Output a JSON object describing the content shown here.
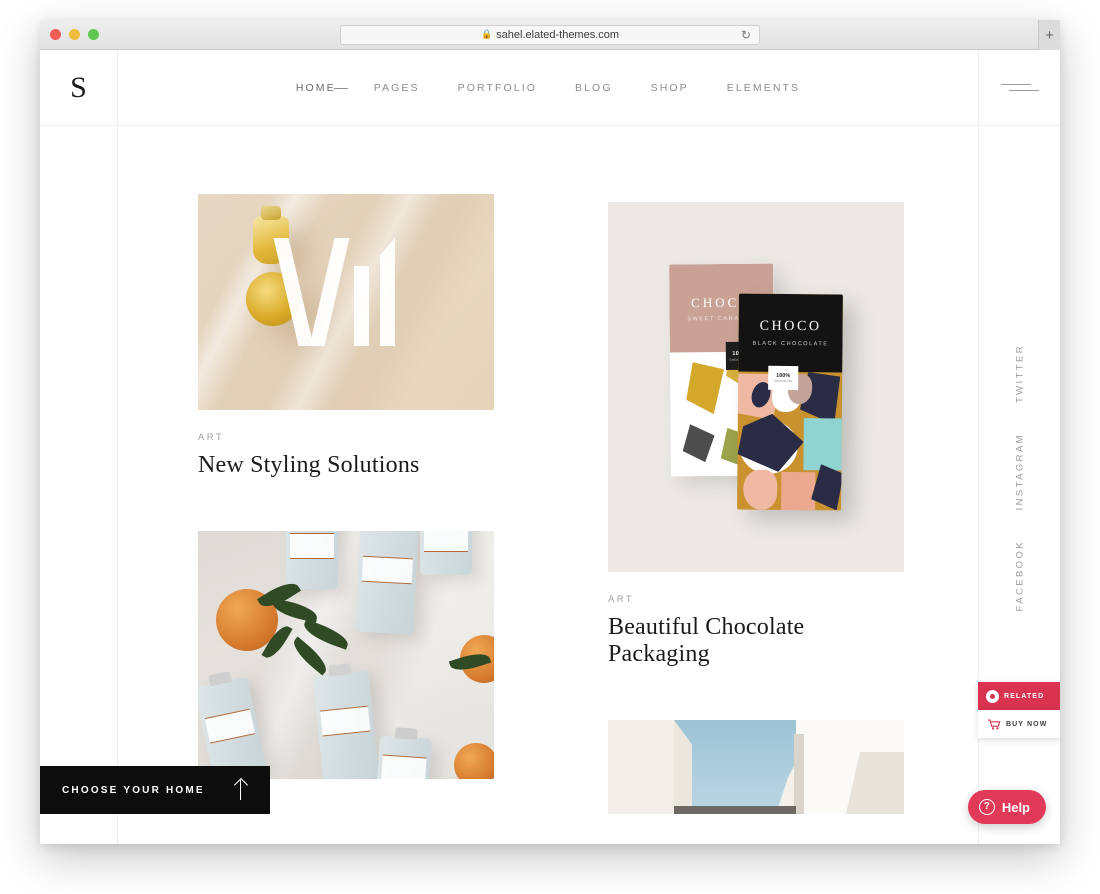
{
  "browser": {
    "url": "sahel.elated-themes.com",
    "lock_icon": "lock-icon",
    "reload_icon": "reload-icon",
    "new_tab_label": "+",
    "traffic_lights": [
      "close",
      "minimize",
      "maximize"
    ]
  },
  "header": {
    "logo": "S",
    "nav": [
      {
        "label": "HOME",
        "active": true
      },
      {
        "label": "PAGES",
        "active": false
      },
      {
        "label": "PORTFOLIO",
        "active": false
      },
      {
        "label": "BLOG",
        "active": false
      },
      {
        "label": "SHOP",
        "active": false
      },
      {
        "label": "ELEMENTS",
        "active": false
      }
    ],
    "menu_icon": "hamburger-icon"
  },
  "social": {
    "items": [
      {
        "label": "TWITTER"
      },
      {
        "label": "INSTAGRAM"
      },
      {
        "label": "FACEBOOK"
      }
    ]
  },
  "portfolio": {
    "left_column": [
      {
        "category": "ART",
        "title": "New Styling Solutions",
        "image": "olive-oil-on-marble"
      },
      {
        "category": "",
        "title": "",
        "image": "bottles-and-oranges"
      }
    ],
    "right_column": [
      {
        "category": "ART",
        "title": "Beautiful Chocolate Packaging",
        "image": "choco-packaging",
        "artwork": {
          "bar_caramel_title": "CHOCO",
          "bar_caramel_sub": "SWEET CARAMEL",
          "bar_caramel_badge": "100%",
          "bar_caramel_badge_sub": "CHOCOLATE",
          "bar_black_title": "CHOCO",
          "bar_black_sub": "BLACK CHOCOLATE",
          "bar_black_badge": "100%",
          "bar_black_badge_sub": "CHOCOLATE"
        }
      },
      {
        "category": "",
        "title": "",
        "image": "minimal-architecture"
      }
    ]
  },
  "widgets": {
    "related": {
      "label": "RELATED",
      "icon": "record-circle-icon",
      "color": "#d9334f"
    },
    "buy_now": {
      "label": "BUY NOW",
      "icon": "cart-icon",
      "color": "#d9334f"
    },
    "help": {
      "label": "Help",
      "icon": "question-circle-icon",
      "color": "#e03a58"
    }
  },
  "choose_home": {
    "label": "CHOOSE YOUR HOME",
    "icon": "arrow-up-icon"
  }
}
